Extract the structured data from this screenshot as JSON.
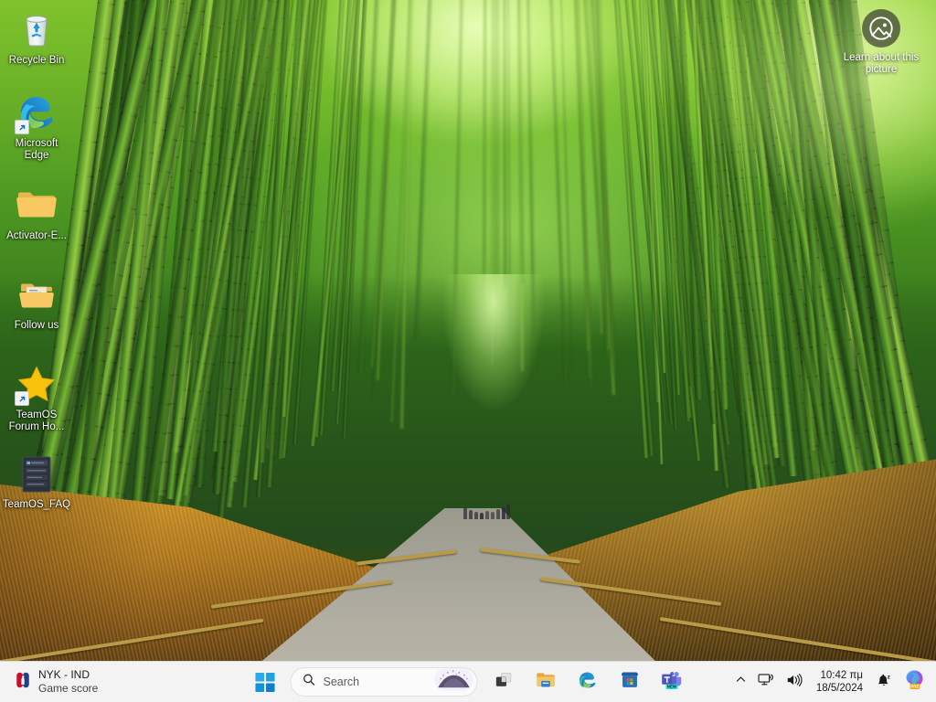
{
  "desktop": {
    "icons": [
      {
        "label": "Recycle Bin",
        "icon": "recycle-bin-icon",
        "shortcut": false
      },
      {
        "label": "Microsoft Edge",
        "icon": "edge-icon",
        "shortcut": true
      },
      {
        "label": "Activator-E...",
        "icon": "folder-icon",
        "shortcut": false
      },
      {
        "label": "Follow us",
        "icon": "folder-with-files-icon",
        "shortcut": false
      },
      {
        "label": "TeamOS Forum Ho...",
        "icon": "star-icon",
        "shortcut": true
      },
      {
        "label": "TeamOS_FAQ",
        "icon": "document-thumbnail-icon",
        "shortcut": false
      }
    ],
    "learn_about_picture": {
      "label": "Learn about this picture",
      "icon": "picture-info-icon"
    }
  },
  "taskbar": {
    "widget": {
      "title": "NYK - IND",
      "subtitle": "Game score",
      "icon": "nba-logo-icon"
    },
    "start": {
      "label": "Start",
      "icon": "windows-logo-icon"
    },
    "search": {
      "placeholder": "Search",
      "icon": "search-icon",
      "thumbnail": "search-highlight-thumbnail"
    },
    "apps": [
      {
        "name": "Task View",
        "icon": "task-view-icon"
      },
      {
        "name": "File Explorer",
        "icon": "file-explorer-icon"
      },
      {
        "name": "Microsoft Edge",
        "icon": "edge-icon"
      },
      {
        "name": "Microsoft Store",
        "icon": "microsoft-store-icon"
      },
      {
        "name": "Microsoft Teams",
        "icon": "teams-icon",
        "badge": "NEW"
      }
    ],
    "tray": {
      "show_hidden_icons": "show-hidden-icons-chevron",
      "network": "network-icon",
      "volume": "volume-icon",
      "notifications": "notification-bell-dnd-icon",
      "copilot": {
        "icon": "copilot-icon",
        "badge": "PRE"
      },
      "clock": {
        "time": "10:42 πμ",
        "date": "18/5/2024"
      }
    }
  },
  "colors": {
    "taskbar_bg": "#f3f3f3",
    "accent_blue": "#0078d4",
    "folder_yellow": "#f7c55a",
    "star_yellow": "#f5bf1d",
    "text_primary": "#1a1a1a"
  }
}
